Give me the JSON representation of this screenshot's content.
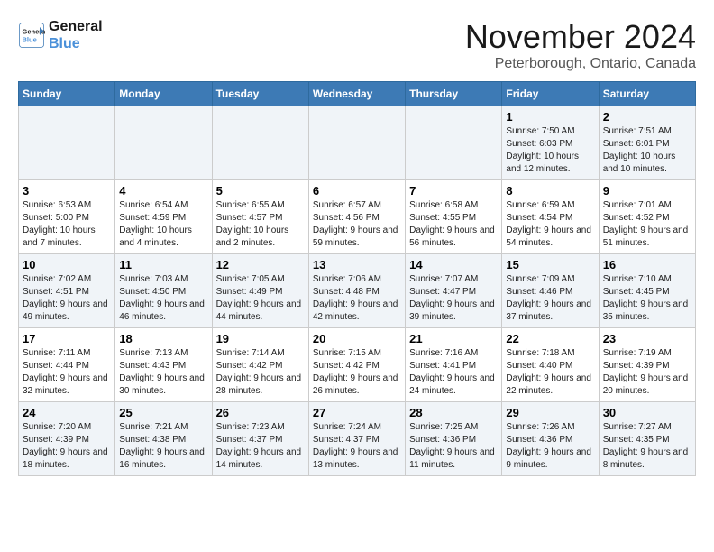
{
  "header": {
    "logo_line1": "General",
    "logo_line2": "Blue",
    "month_title": "November 2024",
    "location": "Peterborough, Ontario, Canada"
  },
  "days_of_week": [
    "Sunday",
    "Monday",
    "Tuesday",
    "Wednesday",
    "Thursday",
    "Friday",
    "Saturday"
  ],
  "weeks": [
    [
      {
        "day": "",
        "info": ""
      },
      {
        "day": "",
        "info": ""
      },
      {
        "day": "",
        "info": ""
      },
      {
        "day": "",
        "info": ""
      },
      {
        "day": "",
        "info": ""
      },
      {
        "day": "1",
        "info": "Sunrise: 7:50 AM\nSunset: 6:03 PM\nDaylight: 10 hours and 12 minutes."
      },
      {
        "day": "2",
        "info": "Sunrise: 7:51 AM\nSunset: 6:01 PM\nDaylight: 10 hours and 10 minutes."
      }
    ],
    [
      {
        "day": "3",
        "info": "Sunrise: 6:53 AM\nSunset: 5:00 PM\nDaylight: 10 hours and 7 minutes."
      },
      {
        "day": "4",
        "info": "Sunrise: 6:54 AM\nSunset: 4:59 PM\nDaylight: 10 hours and 4 minutes."
      },
      {
        "day": "5",
        "info": "Sunrise: 6:55 AM\nSunset: 4:57 PM\nDaylight: 10 hours and 2 minutes."
      },
      {
        "day": "6",
        "info": "Sunrise: 6:57 AM\nSunset: 4:56 PM\nDaylight: 9 hours and 59 minutes."
      },
      {
        "day": "7",
        "info": "Sunrise: 6:58 AM\nSunset: 4:55 PM\nDaylight: 9 hours and 56 minutes."
      },
      {
        "day": "8",
        "info": "Sunrise: 6:59 AM\nSunset: 4:54 PM\nDaylight: 9 hours and 54 minutes."
      },
      {
        "day": "9",
        "info": "Sunrise: 7:01 AM\nSunset: 4:52 PM\nDaylight: 9 hours and 51 minutes."
      }
    ],
    [
      {
        "day": "10",
        "info": "Sunrise: 7:02 AM\nSunset: 4:51 PM\nDaylight: 9 hours and 49 minutes."
      },
      {
        "day": "11",
        "info": "Sunrise: 7:03 AM\nSunset: 4:50 PM\nDaylight: 9 hours and 46 minutes."
      },
      {
        "day": "12",
        "info": "Sunrise: 7:05 AM\nSunset: 4:49 PM\nDaylight: 9 hours and 44 minutes."
      },
      {
        "day": "13",
        "info": "Sunrise: 7:06 AM\nSunset: 4:48 PM\nDaylight: 9 hours and 42 minutes."
      },
      {
        "day": "14",
        "info": "Sunrise: 7:07 AM\nSunset: 4:47 PM\nDaylight: 9 hours and 39 minutes."
      },
      {
        "day": "15",
        "info": "Sunrise: 7:09 AM\nSunset: 4:46 PM\nDaylight: 9 hours and 37 minutes."
      },
      {
        "day": "16",
        "info": "Sunrise: 7:10 AM\nSunset: 4:45 PM\nDaylight: 9 hours and 35 minutes."
      }
    ],
    [
      {
        "day": "17",
        "info": "Sunrise: 7:11 AM\nSunset: 4:44 PM\nDaylight: 9 hours and 32 minutes."
      },
      {
        "day": "18",
        "info": "Sunrise: 7:13 AM\nSunset: 4:43 PM\nDaylight: 9 hours and 30 minutes."
      },
      {
        "day": "19",
        "info": "Sunrise: 7:14 AM\nSunset: 4:42 PM\nDaylight: 9 hours and 28 minutes."
      },
      {
        "day": "20",
        "info": "Sunrise: 7:15 AM\nSunset: 4:42 PM\nDaylight: 9 hours and 26 minutes."
      },
      {
        "day": "21",
        "info": "Sunrise: 7:16 AM\nSunset: 4:41 PM\nDaylight: 9 hours and 24 minutes."
      },
      {
        "day": "22",
        "info": "Sunrise: 7:18 AM\nSunset: 4:40 PM\nDaylight: 9 hours and 22 minutes."
      },
      {
        "day": "23",
        "info": "Sunrise: 7:19 AM\nSunset: 4:39 PM\nDaylight: 9 hours and 20 minutes."
      }
    ],
    [
      {
        "day": "24",
        "info": "Sunrise: 7:20 AM\nSunset: 4:39 PM\nDaylight: 9 hours and 18 minutes."
      },
      {
        "day": "25",
        "info": "Sunrise: 7:21 AM\nSunset: 4:38 PM\nDaylight: 9 hours and 16 minutes."
      },
      {
        "day": "26",
        "info": "Sunrise: 7:23 AM\nSunset: 4:37 PM\nDaylight: 9 hours and 14 minutes."
      },
      {
        "day": "27",
        "info": "Sunrise: 7:24 AM\nSunset: 4:37 PM\nDaylight: 9 hours and 13 minutes."
      },
      {
        "day": "28",
        "info": "Sunrise: 7:25 AM\nSunset: 4:36 PM\nDaylight: 9 hours and 11 minutes."
      },
      {
        "day": "29",
        "info": "Sunrise: 7:26 AM\nSunset: 4:36 PM\nDaylight: 9 hours and 9 minutes."
      },
      {
        "day": "30",
        "info": "Sunrise: 7:27 AM\nSunset: 4:35 PM\nDaylight: 9 hours and 8 minutes."
      }
    ]
  ]
}
